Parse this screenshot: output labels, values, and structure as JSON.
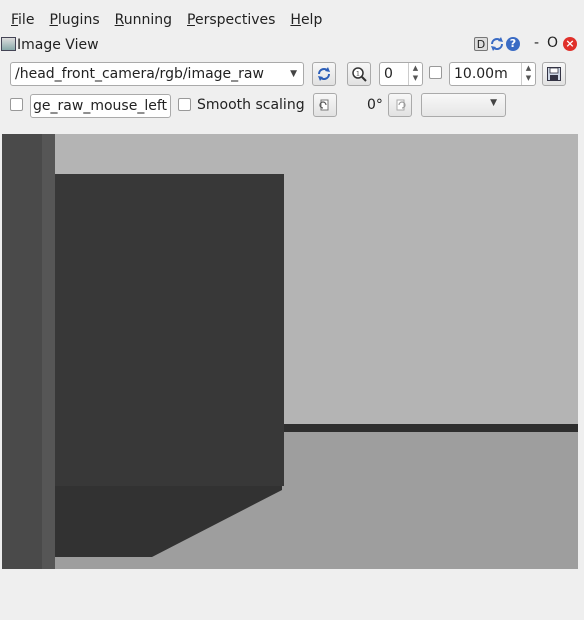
{
  "menubar": {
    "items": [
      {
        "key": "F",
        "rest": "ile"
      },
      {
        "key": "P",
        "rest": "lugins"
      },
      {
        "key": "R",
        "rest": "unning"
      },
      {
        "key": "P",
        "rest": "erspectives",
        "prefix": ""
      },
      {
        "key": "H",
        "rest": "elp"
      }
    ]
  },
  "window": {
    "title": "Image View",
    "d_label": "D",
    "help_label": "?",
    "minimize_label": "-",
    "float_label": "O",
    "close_label": "×"
  },
  "toolbar": {
    "topic": "/head_front_camera/rgb/image_raw",
    "zoom_value": "0",
    "duration_value": "10.00m",
    "mouse_topic": "ge_raw_mouse_left",
    "smooth_scaling_label": "Smooth scaling",
    "rotation_label": "0°",
    "combo2_value": ""
  },
  "colors": {
    "background": "#efefef",
    "wall_light": "#b4b4b4",
    "floor": "#9e9e9e",
    "box_front": "#383838",
    "box_bottom": "#323232",
    "pillar": "#4a4a4a",
    "strip": "#2e2e2e"
  }
}
